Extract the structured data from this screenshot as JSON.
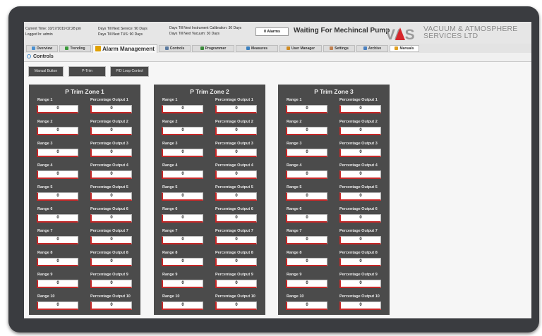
{
  "header": {
    "current_time": "Current Time: 10/17/2019 02:28 pm",
    "logged_in": "Logged In: admin",
    "next_service": "Days Till Next Service: 90 Days",
    "next_tus": "Days Till Next TUS: 90 Days",
    "next_calibration": "Days Till Next Instrument Calibration: 30 Days",
    "next_vacuum": "Days Till Next Vacuum: 30 Days",
    "alarms": "0 Alarms",
    "status": "Waiting For Mechincal Pump",
    "logo_text": "VAS",
    "company_line1": "VACUUM & ATMOSPHERE",
    "company_line2": "SERVICES LTD"
  },
  "tabs": [
    {
      "label": "Overview",
      "icon": "overview-icon",
      "color": "#4a90d0"
    },
    {
      "label": "Trending",
      "icon": "trending-icon",
      "color": "#3a9a3a"
    },
    {
      "label": "Alarm Management",
      "icon": "warning-icon",
      "color": "#e0a000"
    },
    {
      "label": "Controls",
      "icon": "controls-icon",
      "color": "#5a7aa0"
    },
    {
      "label": "Programmer",
      "icon": "programmer-icon",
      "color": "#3a8a3a"
    },
    {
      "label": "Measures",
      "icon": "measures-icon",
      "color": "#3a80c0"
    },
    {
      "label": "User Manager",
      "icon": "user-icon",
      "color": "#d08a20"
    },
    {
      "label": "Settings",
      "icon": "settings-icon",
      "color": "#c08050"
    },
    {
      "label": "Archive",
      "icon": "archive-icon",
      "color": "#4a80c0"
    },
    {
      "label": "Manuals",
      "icon": "manuals-icon",
      "color": "#e0a020"
    }
  ],
  "active_tab": "Alarm Management",
  "breadcrumb": "Controls",
  "subnav": [
    "Manual Button",
    "P-Trim",
    "PID Loop Control"
  ],
  "zones": [
    {
      "title": "P Trim  Zone 1"
    },
    {
      "title": "P Trim  Zone 2"
    },
    {
      "title": "P Trim  Zone 3"
    }
  ],
  "rows": [
    {
      "range": "Range 1",
      "output": "Percentage Output 1"
    },
    {
      "range": "Range 2",
      "output": "Percentage Output 2"
    },
    {
      "range": "Range 3",
      "output": "Percentage Output 3"
    },
    {
      "range": "Range 4",
      "output": "Percentage Output 4"
    },
    {
      "range": "Range 5",
      "output": "Percentage Output 5"
    },
    {
      "range": "Range 6",
      "output": "Percentage Output 6"
    },
    {
      "range": "Range 7",
      "output": "Percentage Output 7"
    },
    {
      "range": "Range 8",
      "output": "Percentage Output 8"
    },
    {
      "range": "Range 9",
      "output": "Percentage Output 9"
    },
    {
      "range": "Range 10",
      "output": "Percentage Output 10"
    }
  ],
  "field_value": "0",
  "colors": {
    "panel": "#4b4b4b",
    "field_accent": "#c62828",
    "logo_red": "#d6262b",
    "logo_grey": "#9a9a9a"
  }
}
